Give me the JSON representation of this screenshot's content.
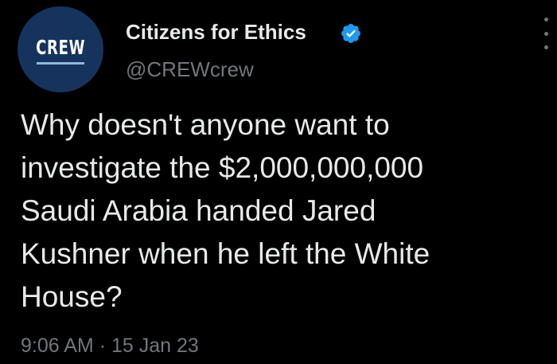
{
  "author": {
    "avatar_text": "CREW",
    "display_name": "Citizens for Ethics",
    "handle": "@CREWcrew",
    "verified": true
  },
  "tweet": {
    "text": "Why doesn't anyone want to\ninvestigate the $2,000,000,000\nSaudi Arabia handed Jared\nKushner when he left the White\nHouse?",
    "time": "9:06 AM",
    "separator": "·",
    "date": "15 Jan 23"
  },
  "icons": {
    "verified": "verified-badge-icon",
    "more": "more-options-icon"
  },
  "colors": {
    "background": "#000000",
    "primary_text": "#e7e9ea",
    "secondary_text": "#71767b",
    "verified_blue": "#1d9bf0",
    "avatar_bg": "#16335e"
  }
}
